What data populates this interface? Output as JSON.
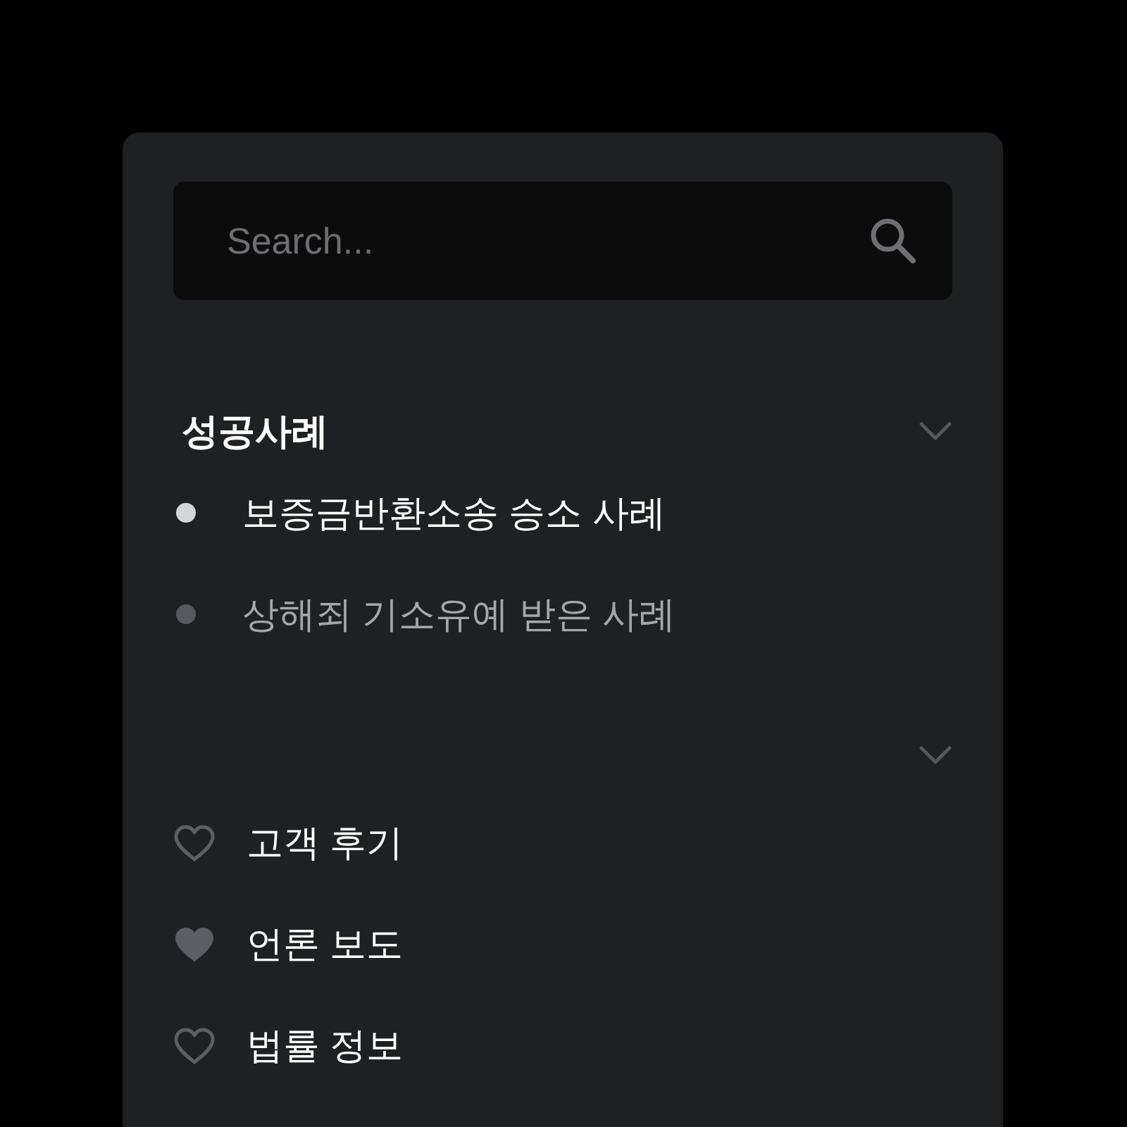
{
  "search": {
    "placeholder": "Search..."
  },
  "sections": [
    {
      "title": "성공사례",
      "kind": "bullet",
      "items": [
        {
          "label": "보증금반환소송 승소 사례",
          "selected": true
        },
        {
          "label": "상해죄 기소유예 받은 사례",
          "selected": false
        }
      ]
    },
    {
      "kind": "heart",
      "items": [
        {
          "label": "고객 후기",
          "liked": false
        },
        {
          "label": "언론 보도",
          "liked": true
        },
        {
          "label": "법률 정보",
          "liked": false
        }
      ]
    }
  ]
}
